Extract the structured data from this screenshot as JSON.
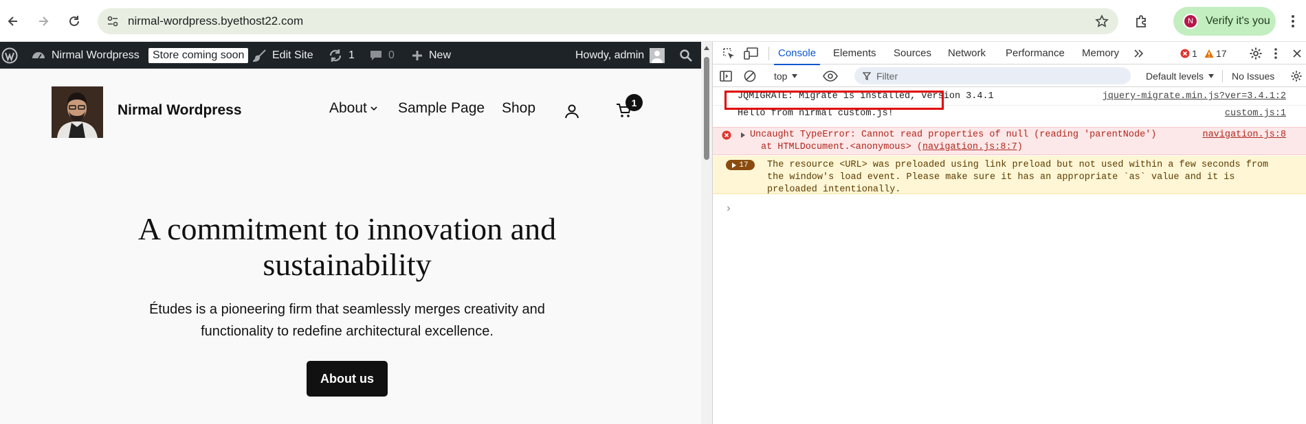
{
  "browser": {
    "url": "nirmal-wordpress.byethost22.com",
    "verify_label": "Verify it's you",
    "avatar_letter": "N"
  },
  "adminbar": {
    "site_name": "Nirmal Wordpress",
    "store_badge": "Store coming soon",
    "edit_site": "Edit Site",
    "updates_count": "1",
    "comments_count": "0",
    "new_label": "New",
    "howdy": "Howdy, admin"
  },
  "site": {
    "title": "Nirmal Wordpress",
    "nav": [
      "About",
      "Sample Page",
      "Shop"
    ],
    "cart_count": "1",
    "hero_title": "A commitment to innovation and sustainability",
    "hero_text": "Études is a pioneering firm that seamlessly merges creativity and functionality to redefine architectural excellence.",
    "cta": "About us"
  },
  "devtools": {
    "tabs": [
      "Console",
      "Elements",
      "Sources",
      "Network",
      "Performance",
      "Memory"
    ],
    "active_tab": "Console",
    "error_count": "1",
    "warning_count": "17",
    "context": "top",
    "filter_placeholder": "Filter",
    "levels": "Default levels",
    "issues": "No Issues",
    "messages": [
      {
        "type": "log",
        "text": "JQMIGRATE: Migrate is installed, version 3.4.1",
        "source": "jquery-migrate.min.js?ver=3.4.1:2"
      },
      {
        "type": "log",
        "text": "Hello from nirmal custom.js!",
        "source": "custom.js:1"
      },
      {
        "type": "error",
        "text": "Uncaught TypeError: Cannot read properties of null (reading 'parentNode')",
        "text2_prefix": "at HTMLDocument.<anonymous> (",
        "text2_link": "navigation.js:8:7",
        "text2_suffix": ")",
        "source": "navigation.js:8"
      },
      {
        "type": "warning",
        "count": "17",
        "line1": "The resource <URL> was preloaded using link preload but not used within a few seconds from",
        "line2": "the window's load event. Please make sure it has an appropriate `as` value and it is",
        "line3": "preloaded intentionally."
      }
    ],
    "prompt": "›"
  },
  "colors": {
    "accent": "#0b57d0",
    "error": "#dc362e",
    "warning": "#e37400",
    "highlight": "#e00000"
  }
}
